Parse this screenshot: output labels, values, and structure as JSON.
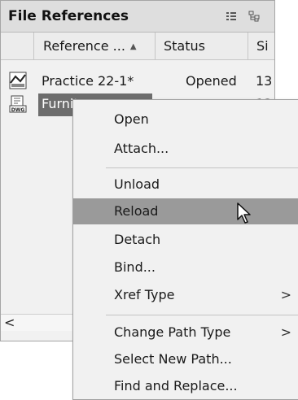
{
  "palette": {
    "title": "File References",
    "header_icons": [
      "list-view-icon",
      "tree-view-icon"
    ],
    "columns": [
      "Reference ...",
      "Status",
      "Si"
    ],
    "sort": "ascending",
    "rows": [
      {
        "icon": "drawing-file-icon",
        "name": "Practice 22-1*",
        "status": "Opened",
        "size": "13"
      },
      {
        "icon": "dwg-xref-icon",
        "name": "Furnit",
        "status": "",
        "size": "13"
      }
    ],
    "scroll_left_glyph": "<"
  },
  "context_menu": {
    "items": [
      {
        "label": "Open"
      },
      {
        "label": "Attach..."
      },
      {
        "label": "Unload"
      },
      {
        "label": "Reload",
        "highlighted": true
      },
      {
        "label": "Detach"
      },
      {
        "label": "Bind..."
      },
      {
        "label": "Xref Type",
        "submenu": ">"
      },
      {
        "label": "Change Path Type",
        "submenu": ">"
      },
      {
        "label": "Select New Path..."
      },
      {
        "label": "Find and Replace..."
      }
    ]
  },
  "colors": {
    "highlight": "#9a9a9a",
    "selected_row": "#6d6d6d",
    "panel_bg": "#f1f1f1"
  }
}
